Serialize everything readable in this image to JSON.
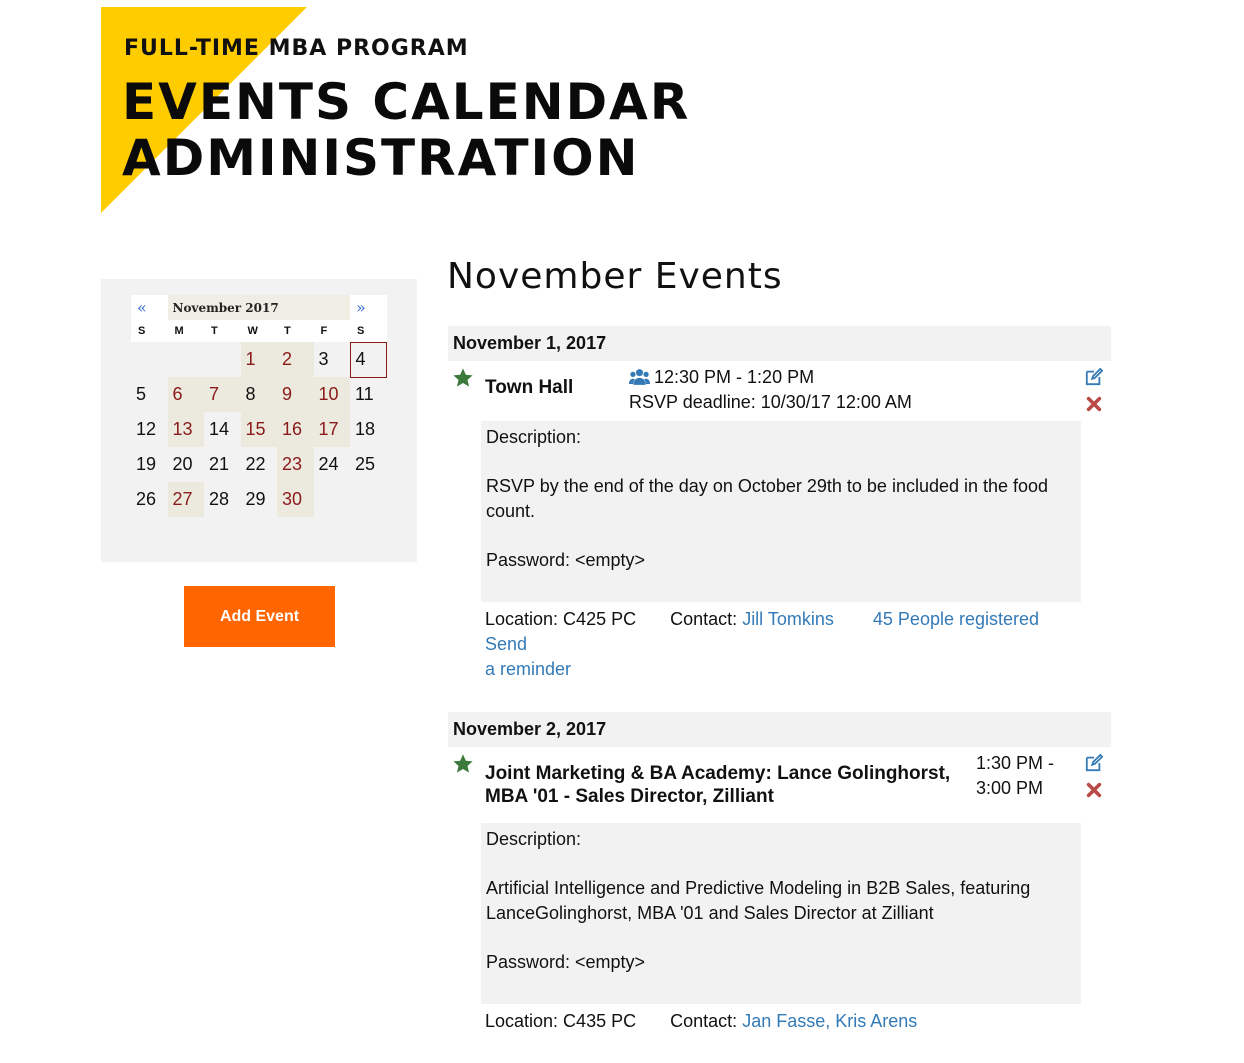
{
  "header": {
    "program": "FULL-TIME MBA PROGRAM",
    "title_line1": "EVENTS CALENDAR",
    "title_line2": "ADMINISTRATION"
  },
  "calendar": {
    "prev": "«",
    "next": "»",
    "month_label": "November 2017",
    "weekdays": [
      "S",
      "M",
      "T",
      "W",
      "T",
      "F",
      "S"
    ],
    "weeks": [
      [
        "",
        "",
        "",
        "1",
        "2",
        "3",
        "4"
      ],
      [
        "5",
        "6",
        "7",
        "8",
        "9",
        "10",
        "11"
      ],
      [
        "12",
        "13",
        "14",
        "15",
        "16",
        "17",
        "18"
      ],
      [
        "19",
        "20",
        "21",
        "22",
        "23",
        "24",
        "25"
      ],
      [
        "26",
        "27",
        "28",
        "29",
        "30",
        "",
        ""
      ]
    ]
  },
  "add_event_label": "Add Event",
  "events_heading": "November Events",
  "events": [
    {
      "date": "November 1, 2017",
      "name": "Town Hall",
      "time": "12:30 PM - 1:20 PM",
      "rsvp": "RSVP deadline: 10/30/17 12:00 AM",
      "desc_label": "Description:",
      "desc_text": "RSVP by the end of the day on October 29th to be included in the food count.",
      "password": "Password: <empty>",
      "location": "Location: C425 PC",
      "contact_label": "Contact:",
      "contact": "Jill Tomkins",
      "registered": "45 People registered",
      "reminder_a": "Send",
      "reminder_b": "a reminder"
    },
    {
      "date": "November 2, 2017",
      "name_line1": "Joint Marketing & BA Academy: Lance Golinghorst,",
      "name_line2": "MBA '01 - Sales Director, Zilliant",
      "time_line1": "1:30 PM -",
      "time_line2": "3:00 PM",
      "desc_label": "Description:",
      "desc_text_line1": "Artificial Intelligence and Predictive Modeling in B2B Sales, featuring",
      "desc_text_line2": "LanceGolinghorst, MBA '01 and Sales Director at Zilliant",
      "password": "Password: <empty>",
      "location": "Location: C435 PC",
      "contact_label": "Contact:",
      "contact": "Jan Fasse, Kris Arens"
    }
  ],
  "colors": {
    "brand_yellow": "#ffcc00",
    "button_orange": "#ff6600",
    "event_day_red": "#8b1a1a",
    "link_blue": "#337ab7",
    "star_green": "#3c7a3c",
    "delete_red": "#b94a48"
  },
  "icons": {
    "featured": "star-icon",
    "audience": "users-icon",
    "edit": "edit-icon",
    "delete": "delete-x-icon"
  }
}
